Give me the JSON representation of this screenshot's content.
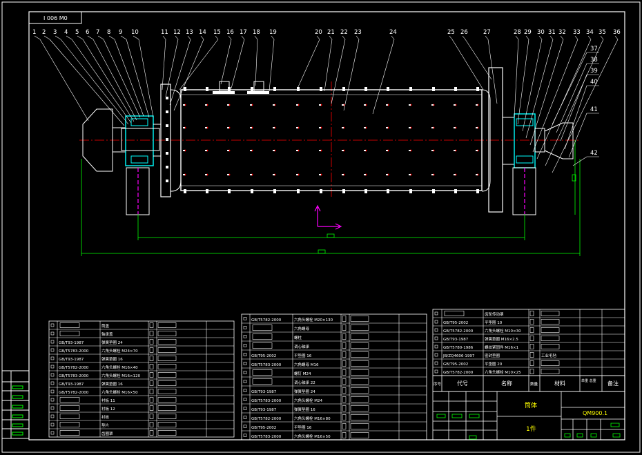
{
  "title_tag": "I 006 M0",
  "drawing_name": "筒体",
  "drawing_code": "QM900.1",
  "part_label": "1件",
  "header_labels": {
    "seq": "序号",
    "code": "代号",
    "name": "名称",
    "qty": "数量",
    "material": "材料",
    "weight": "单重 总重",
    "remark": "备注"
  },
  "callouts": [
    "1",
    "2",
    "3",
    "4",
    "5",
    "6",
    "7",
    "8",
    "9",
    "10",
    "11",
    "12",
    "13",
    "14",
    "15",
    "16",
    "17",
    "18",
    "19",
    "20",
    "21",
    "22",
    "23",
    "24",
    "25",
    "26",
    "27",
    "28",
    "29",
    "30",
    "31",
    "32",
    "33",
    "34",
    "35",
    "36",
    "37",
    "38",
    "39",
    "40",
    "41",
    "42"
  ],
  "right_table_rows": [
    {
      "code": "",
      "name": "齿轮传动罩",
      "mat": ""
    },
    {
      "code": "GB/T95-2002",
      "name": "平垫圈 10",
      "mat": ""
    },
    {
      "code": "GB/T5782-2000",
      "name": "六角头螺栓 M10×30",
      "mat": ""
    },
    {
      "code": "GB/T93-1987",
      "name": "弹簧垫圈 M16×2.5",
      "mat": ""
    },
    {
      "code": "GB/T5780-1986",
      "name": "螺纹紧固件 M16×1",
      "mat": ""
    },
    {
      "code": "JB/ZQ4606-1997",
      "name": "密封垫圈",
      "mat": "工业毛毡"
    },
    {
      "code": "GB/T95-2002",
      "name": "平垫圈 20",
      "mat": ""
    },
    {
      "code": "GB/T5782-2000",
      "name": "六角头螺栓 M10×25",
      "mat": ""
    }
  ],
  "left_table_rows": [
    {
      "code": "",
      "name": "筒盖"
    },
    {
      "code": "",
      "name": "轴承盖"
    },
    {
      "code": "GB/T93-1987",
      "name": "弹簧垫圈 24"
    },
    {
      "code": "GB/T5783-2000",
      "name": "六角头螺栓 M24×70"
    },
    {
      "code": "GB/T93-1987",
      "name": "弹簧垫圈 16"
    },
    {
      "code": "GB/T5782-2000",
      "name": "六角头螺栓 M16×40"
    },
    {
      "code": "GB/T5783-2000",
      "name": "六角头螺栓 M16×120"
    },
    {
      "code": "GB/T93-1987",
      "name": "弹簧垫圈 16"
    },
    {
      "code": "GB/T5782-2000",
      "name": "六角头螺栓 M16×50"
    },
    {
      "code": "",
      "name": "衬板 11"
    },
    {
      "code": "",
      "name": "衬板 12"
    },
    {
      "code": "",
      "name": "衬板"
    },
    {
      "code": "",
      "name": "垫片"
    },
    {
      "code": "",
      "name": "齿圈罩"
    }
  ],
  "mid_table_rows": [
    {
      "code": "GB/T5782-2000",
      "name": "六角头螺栓 M20×130"
    },
    {
      "code": "",
      "name": "六角螺母"
    },
    {
      "code": "",
      "name": "螺柱"
    },
    {
      "code": "",
      "name": "调心轴承"
    },
    {
      "code": "GB/T95-2002",
      "name": "平垫圈 16"
    },
    {
      "code": "GB/T5783-2000",
      "name": "六角螺母 M16"
    },
    {
      "code": "",
      "name": "螺钉 M24"
    },
    {
      "code": "",
      "name": "调心轴承 22"
    },
    {
      "code": "GB/T93-1987",
      "name": "弹簧垫圈 24"
    },
    {
      "code": "GB/T5783-2000",
      "name": "六角头螺栓 M24"
    },
    {
      "code": "GB/T93-1987",
      "name": "弹簧垫圈 16"
    },
    {
      "code": "GB/T5782-2000",
      "name": "六角头螺栓 M16×80"
    },
    {
      "code": "GB/T95-2002",
      "name": "平垫圈 16"
    },
    {
      "code": "GB/T5783-2000",
      "name": "六角头螺栓 M16×50"
    }
  ]
}
